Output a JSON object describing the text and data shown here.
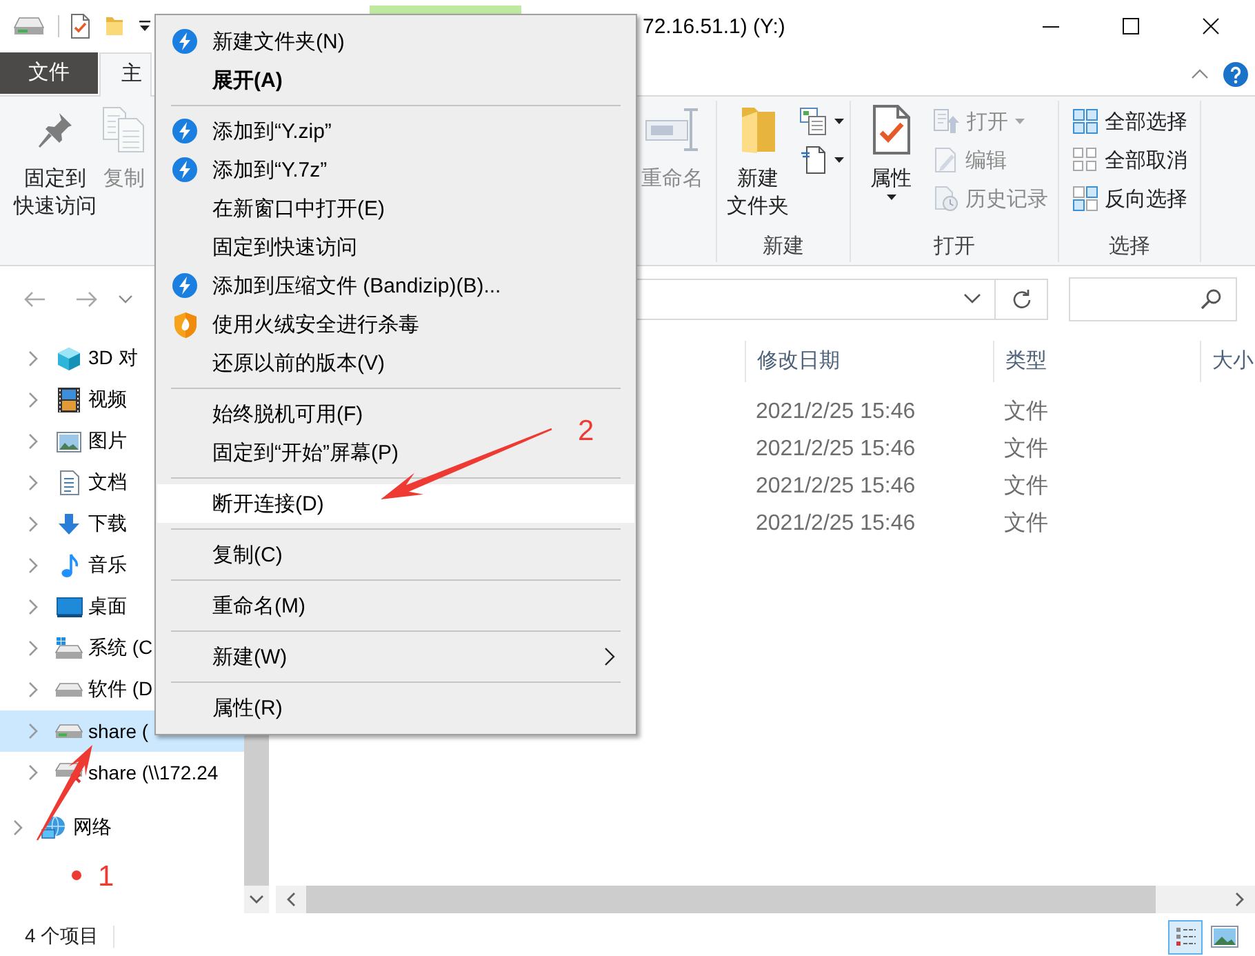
{
  "title_bar": {
    "title": "72.16.51.1) (Y:)"
  },
  "ribbon_tabs": [
    {
      "label": "文件",
      "kind": "file",
      "selected": false
    },
    {
      "label": "主",
      "kind": "tab",
      "selected": true
    }
  ],
  "ribbon_groups": [
    {
      "buttons": [
        {
          "kind": "large",
          "lines": [
            "固定到",
            "快速访问"
          ],
          "disabled": false,
          "dropdown": false
        },
        {
          "kind": "large",
          "lines": [
            "复制"
          ],
          "disabled": true,
          "dropdown": false
        }
      ]
    },
    {
      "buttons": [
        {
          "kind": "large",
          "lines": [
            "重命名"
          ],
          "disabled": true,
          "dropdown": false
        }
      ]
    },
    {
      "label": "新建",
      "buttons": [
        {
          "kind": "large",
          "lines": [
            "新建",
            "文件夹"
          ],
          "disabled": false,
          "dropdown": false
        },
        {
          "kind": "icon",
          "disabled": false,
          "dropdown": true
        },
        {
          "kind": "icon",
          "disabled": false,
          "dropdown": true
        }
      ]
    },
    {
      "label": "打开",
      "buttons": [
        {
          "kind": "large",
          "lines": [
            "属性"
          ],
          "disabled": false,
          "dropdown": true
        },
        {
          "kind": "small",
          "lines": [
            "打开"
          ],
          "disabled": true,
          "dropdown": true
        },
        {
          "kind": "small",
          "lines": [
            "编辑"
          ],
          "disabled": true,
          "dropdown": false
        },
        {
          "kind": "small",
          "lines": [
            "历史记录"
          ],
          "disabled": true,
          "dropdown": false
        }
      ]
    },
    {
      "label": "选择",
      "buttons": [
        {
          "kind": "small",
          "lines": [
            "全部选择"
          ],
          "disabled": false,
          "dropdown": false
        },
        {
          "kind": "small",
          "lines": [
            "全部取消"
          ],
          "disabled": false,
          "dropdown": false
        },
        {
          "kind": "small",
          "lines": [
            "反向选择"
          ],
          "disabled": false,
          "dropdown": false
        }
      ]
    }
  ],
  "navigation_tree": [
    {
      "children": [
        {
          "label": "3D 对",
          "expanded": false,
          "selected": false
        },
        {
          "label": "视频",
          "expanded": false,
          "selected": false
        },
        {
          "label": "图片",
          "expanded": false,
          "selected": false
        },
        {
          "label": "文档",
          "expanded": false,
          "selected": false
        },
        {
          "label": "下载",
          "expanded": false,
          "selected": false
        },
        {
          "label": "音乐",
          "expanded": false,
          "selected": false
        },
        {
          "label": "桌面",
          "expanded": false,
          "selected": false
        },
        {
          "label": "系统 (C",
          "expanded": false,
          "selected": false
        },
        {
          "label": "软件 (D",
          "expanded": false,
          "selected": false
        },
        {
          "label": "share (",
          "expanded": false,
          "selected": true
        },
        {
          "label": "share (\\\\172.24",
          "expanded": false,
          "selected": false
        }
      ]
    },
    {
      "label": "网络",
      "expanded": false,
      "selected": false
    }
  ],
  "file_list": {
    "columns": [
      {
        "label": "修改日期"
      },
      {
        "label": "类型"
      },
      {
        "label": "大小"
      }
    ],
    "rows": [
      {
        "cells": [
          "2021/2/25 15:46",
          "文件"
        ]
      },
      {
        "cells": [
          "2021/2/25 15:46",
          "文件"
        ]
      },
      {
        "cells": [
          "2021/2/25 15:46",
          "文件"
        ]
      },
      {
        "cells": [
          "2021/2/25 15:46",
          "文件"
        ]
      }
    ]
  },
  "status_bar": {
    "item_count": "4 个项目",
    "views": [
      {
        "selected": true
      },
      {
        "selected": false
      }
    ]
  },
  "context_menu": {
    "items": [
      {
        "kind": "item",
        "label": "新建文件夹(N)",
        "default": false,
        "selected": false,
        "submenu": false
      },
      {
        "kind": "item",
        "label": "展开(A)",
        "default": true,
        "selected": false,
        "submenu": false
      },
      {
        "kind": "separator"
      },
      {
        "kind": "item",
        "label": "添加到“Y.zip”",
        "default": false,
        "selected": false,
        "submenu": false
      },
      {
        "kind": "item",
        "label": "添加到“Y.7z”",
        "default": false,
        "selected": false,
        "submenu": false
      },
      {
        "kind": "item",
        "label": "在新窗口中打开(E)",
        "default": false,
        "selected": false,
        "submenu": false
      },
      {
        "kind": "item",
        "label": "固定到快速访问",
        "default": false,
        "selected": false,
        "submenu": false
      },
      {
        "kind": "item",
        "label": "添加到压缩文件 (Bandizip)(B)...",
        "default": false,
        "selected": false,
        "submenu": false
      },
      {
        "kind": "item",
        "label": "使用火绒安全进行杀毒",
        "default": false,
        "selected": false,
        "submenu": false
      },
      {
        "kind": "item",
        "label": "还原以前的版本(V)",
        "default": false,
        "selected": false,
        "submenu": false
      },
      {
        "kind": "separator"
      },
      {
        "kind": "item",
        "label": "始终脱机可用(F)",
        "default": false,
        "selected": false,
        "submenu": false
      },
      {
        "kind": "item",
        "label": "固定到“开始”屏幕(P)",
        "default": false,
        "selected": false,
        "submenu": false
      },
      {
        "kind": "separator"
      },
      {
        "kind": "item",
        "label": "断开连接(D)",
        "default": false,
        "selected": true,
        "submenu": false
      },
      {
        "kind": "separator"
      },
      {
        "kind": "item",
        "label": "复制(C)",
        "default": false,
        "selected": false,
        "submenu": false
      },
      {
        "kind": "separator"
      },
      {
        "kind": "item",
        "label": "重命名(M)",
        "default": false,
        "selected": false,
        "submenu": false
      },
      {
        "kind": "separator"
      },
      {
        "kind": "item",
        "label": "新建(W)",
        "default": false,
        "selected": false,
        "submenu": true
      },
      {
        "kind": "separator"
      },
      {
        "kind": "item",
        "label": "属性(R)",
        "default": false,
        "selected": false,
        "submenu": false
      }
    ]
  },
  "annotations": [
    {
      "label": "1"
    },
    {
      "label": "2"
    }
  ]
}
